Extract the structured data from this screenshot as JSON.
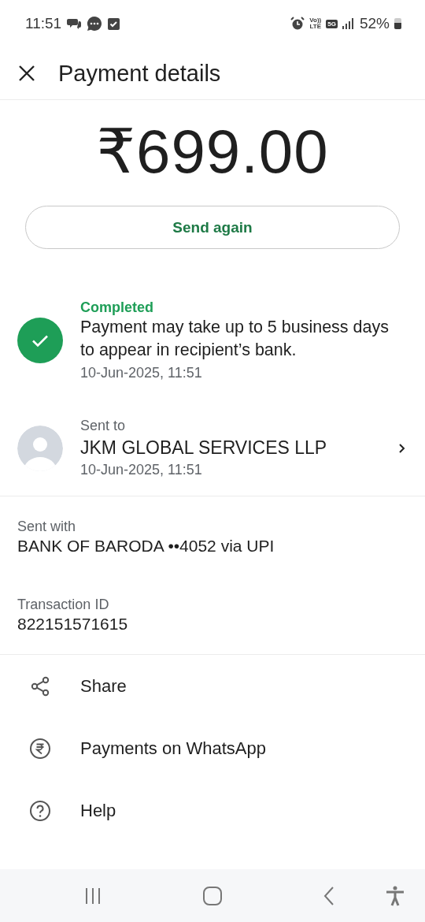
{
  "status_bar": {
    "time": "11:51",
    "volte_top": "Vo))",
    "volte_bottom": "LTE",
    "network": "5G",
    "battery": "52%"
  },
  "header": {
    "title": "Payment details"
  },
  "amount": "₹699.00",
  "send_again": "Send again",
  "status": {
    "label": "Completed",
    "message": "Payment may take up to 5 business days to appear in recipient’s bank.",
    "time": "10-Jun-2025, 11:51"
  },
  "recipient": {
    "caption": "Sent to",
    "name": "JKM GLOBAL SERVICES LLP",
    "time": "10-Jun-2025, 11:51"
  },
  "details": [
    {
      "label": "Sent with",
      "value": "BANK OF BARODA ••4052 via UPI"
    },
    {
      "label": "Transaction ID",
      "value": "822151571615"
    }
  ],
  "actions": [
    {
      "kind": "share",
      "label": "Share"
    },
    {
      "kind": "rupee",
      "label": "Payments on WhatsApp"
    },
    {
      "kind": "help",
      "label": "Help"
    }
  ]
}
